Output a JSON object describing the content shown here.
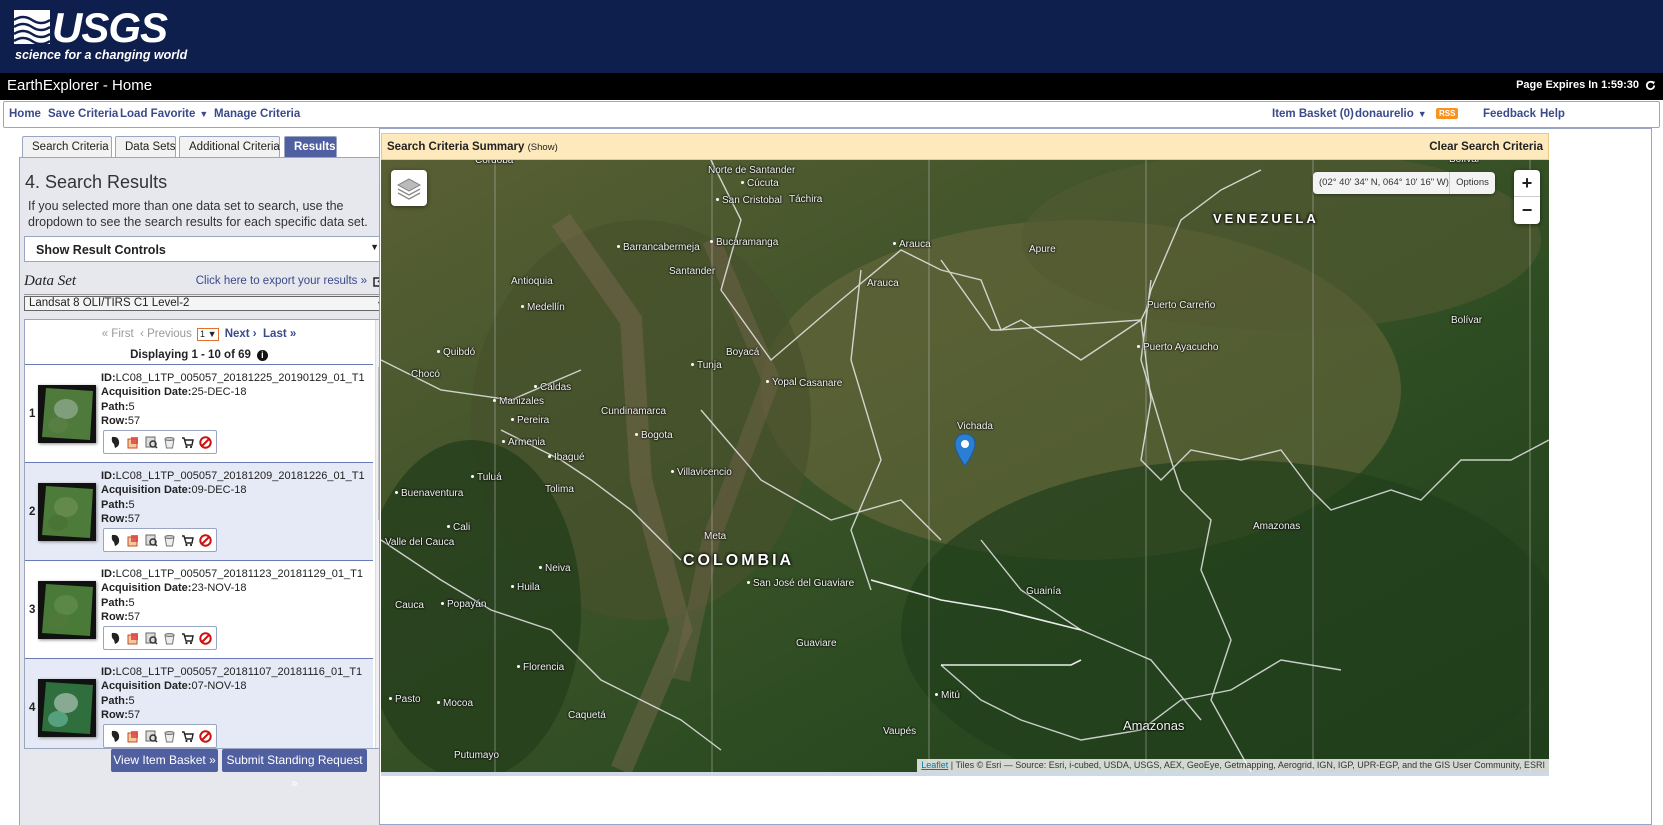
{
  "header": {
    "logo_text": "USGS",
    "logo_tagline": "science for a changing world",
    "app_title": "EarthExplorer - Home",
    "page_expires": "Page Expires In 1:59:30"
  },
  "nav": {
    "home": "Home",
    "save_criteria": "Save Criteria",
    "load_favorite": "Load Favorite",
    "manage_criteria": "Manage Criteria",
    "item_basket": "Item Basket (0)",
    "user": "donaurelio",
    "rss": "RSS",
    "feedback": "Feedback",
    "help": "Help"
  },
  "tabs": [
    {
      "label": "Search Criteria"
    },
    {
      "label": "Data Sets"
    },
    {
      "label": "Additional Criteria"
    },
    {
      "label": "Results"
    }
  ],
  "results_panel": {
    "heading": "4. Search Results",
    "description": "If you selected more than one data set to search, use the dropdown to see the search results for each specific data set.",
    "show_controls": "Show Result Controls",
    "dataset_label": "Data Set",
    "export_link": "Click here to export your results »",
    "dataset_selected": "Landsat 8 OLI/TIRS C1 Level-2",
    "pager": {
      "first": "« First",
      "previous": "‹ Previous",
      "page": "1",
      "next": "Next ›",
      "last": "Last »"
    },
    "display_count": "Displaying 1 - 10 of 69"
  },
  "labels": {
    "id": "ID:",
    "acq_date": "Acquisition Date:",
    "path": "Path:",
    "row": "Row:"
  },
  "results": [
    {
      "num": "1",
      "id": "LC08_L1TP_005057_20181225_20190129_01_T1",
      "date": "25-DEC-18",
      "path": "5",
      "row": "57"
    },
    {
      "num": "2",
      "id": "LC08_L1TP_005057_20181209_20181226_01_T1",
      "date": "09-DEC-18",
      "path": "5",
      "row": "57"
    },
    {
      "num": "3",
      "id": "LC08_L1TP_005057_20181123_20181129_01_T1",
      "date": "23-NOV-18",
      "path": "5",
      "row": "57"
    },
    {
      "num": "4",
      "id": "LC08_L1TP_005057_20181107_20181116_01_T1",
      "date": "07-NOV-18",
      "path": "5",
      "row": "57"
    }
  ],
  "actions": [
    "footprint-icon",
    "overlay-icon",
    "compare-icon",
    "bulk-download-icon",
    "cart-icon",
    "exclude-icon"
  ],
  "buttons": {
    "view_basket": "View Item Basket »",
    "standing_request": "Submit Standing Request »"
  },
  "map": {
    "criteria_summary": "Search Criteria Summary",
    "criteria_show": "(Show)",
    "clear_criteria": "Clear Search Criteria",
    "coordinates": "(02° 40' 34\" N, 064° 10' 16\" W)",
    "options": "Options",
    "zoom_in": "+",
    "zoom_out": "−",
    "attribution_leaflet": "Leaflet",
    "attribution_text": " | Tiles © Esri — Source: Esri, i-cubed, USDA, USGS, AEX, GeoEye, Getmapping, Aerogrid, IGN, IGP, UPR-EGP, and the GIS User Community, ESRI",
    "countries": {
      "venezuela": "VENEZUELA",
      "colombia": "COLOMBIA"
    },
    "places": [
      "Córdoba",
      "Norte de Santander",
      "Cúcuta",
      "San Cristobal",
      "Táchira",
      "Barrancabermeja",
      "Bucaramanga",
      "Santander",
      "Arauca",
      "Apure",
      "Arauca",
      "Antioquia",
      "Medellín",
      "Puerto Carreño",
      "Bolívar",
      "Quibdó",
      "Boyacá",
      "Puerto Ayacucho",
      "Chocó",
      "Tunja",
      "Yopal",
      "Casanare",
      "Caldas",
      "Manizales",
      "Cundinamarca",
      "Pereira",
      "Armenia",
      "Ibagué",
      "Bogota",
      "Vichada",
      "Tuluá",
      "Villavicencio",
      "Tolima",
      "Buenaventura",
      "Amazonas",
      "Cali",
      "Valle del Cauca",
      "Meta",
      "Neiva",
      "San José del Guaviare",
      "Huila",
      "Guainía",
      "Cauca",
      "Popayán",
      "Guaviare",
      "Florencia",
      "Mitú",
      "Pasto",
      "Mocoa",
      "Caquetá",
      "Vaupés",
      "Amazonas",
      "Putumayo",
      "Bolívar"
    ]
  },
  "colors": {
    "header_bg": "#0f1f4d",
    "accent": "#4f5fa0",
    "criteria_bg": "#fde9bc",
    "marker": "#2a7fd4"
  }
}
